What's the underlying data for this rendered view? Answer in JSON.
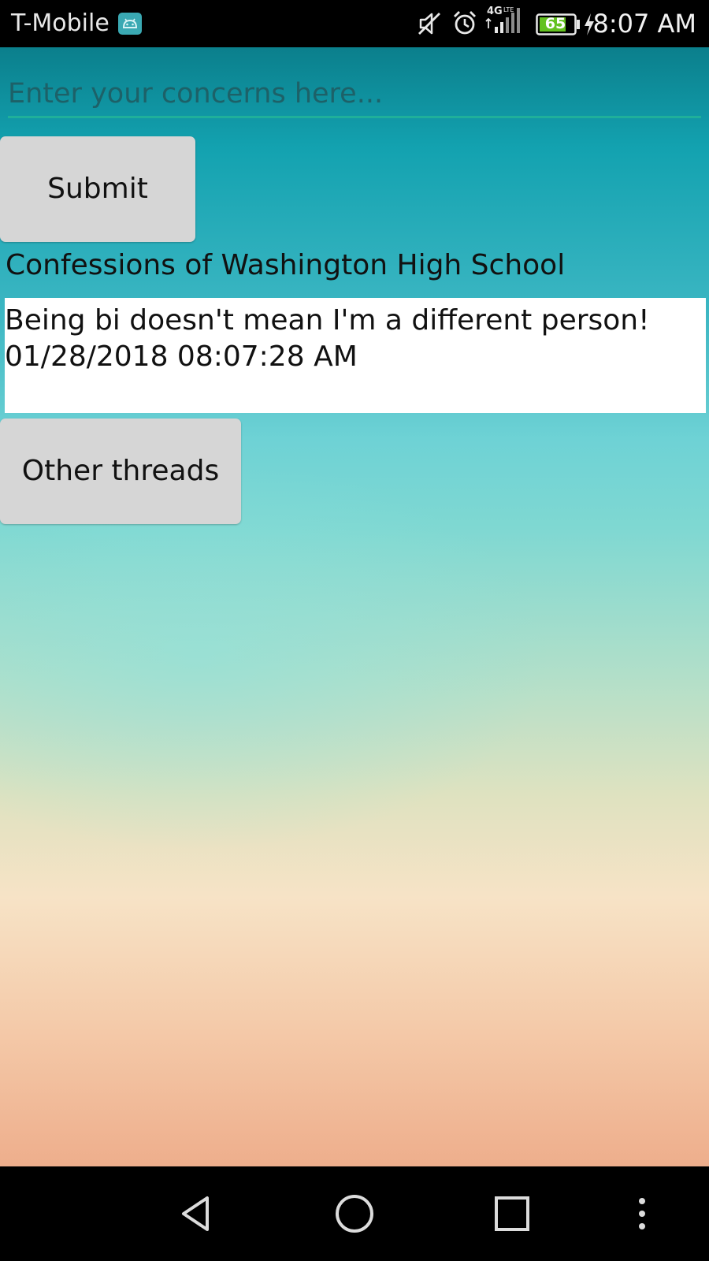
{
  "status_bar": {
    "carrier": "T-Mobile",
    "network_type": "4G LTE",
    "battery_level": "65",
    "time": "8:07 AM",
    "icons": [
      "android-notification-icon",
      "mute-icon",
      "alarm-icon",
      "signal-icon",
      "battery-icon",
      "charging-icon"
    ]
  },
  "form": {
    "concern_placeholder": "Enter your concerns here...",
    "concern_value": "",
    "submit_label": "Submit"
  },
  "thread": {
    "title": "Confessions of Washington High School",
    "posts": [
      {
        "text": "Being bi doesn't mean I'm a different person!",
        "timestamp": "01/28/2018 08:07:28 AM"
      }
    ]
  },
  "other_threads_label": "Other threads",
  "nav_bar": {
    "icons": [
      "back-icon",
      "home-icon",
      "recents-icon",
      "menu-icon"
    ]
  },
  "colors": {
    "input_underline": "#1fb09a",
    "button_bg": "#d6d6d6",
    "gradient_top": "#0b7f8c",
    "gradient_bottom": "#eeae8c"
  }
}
